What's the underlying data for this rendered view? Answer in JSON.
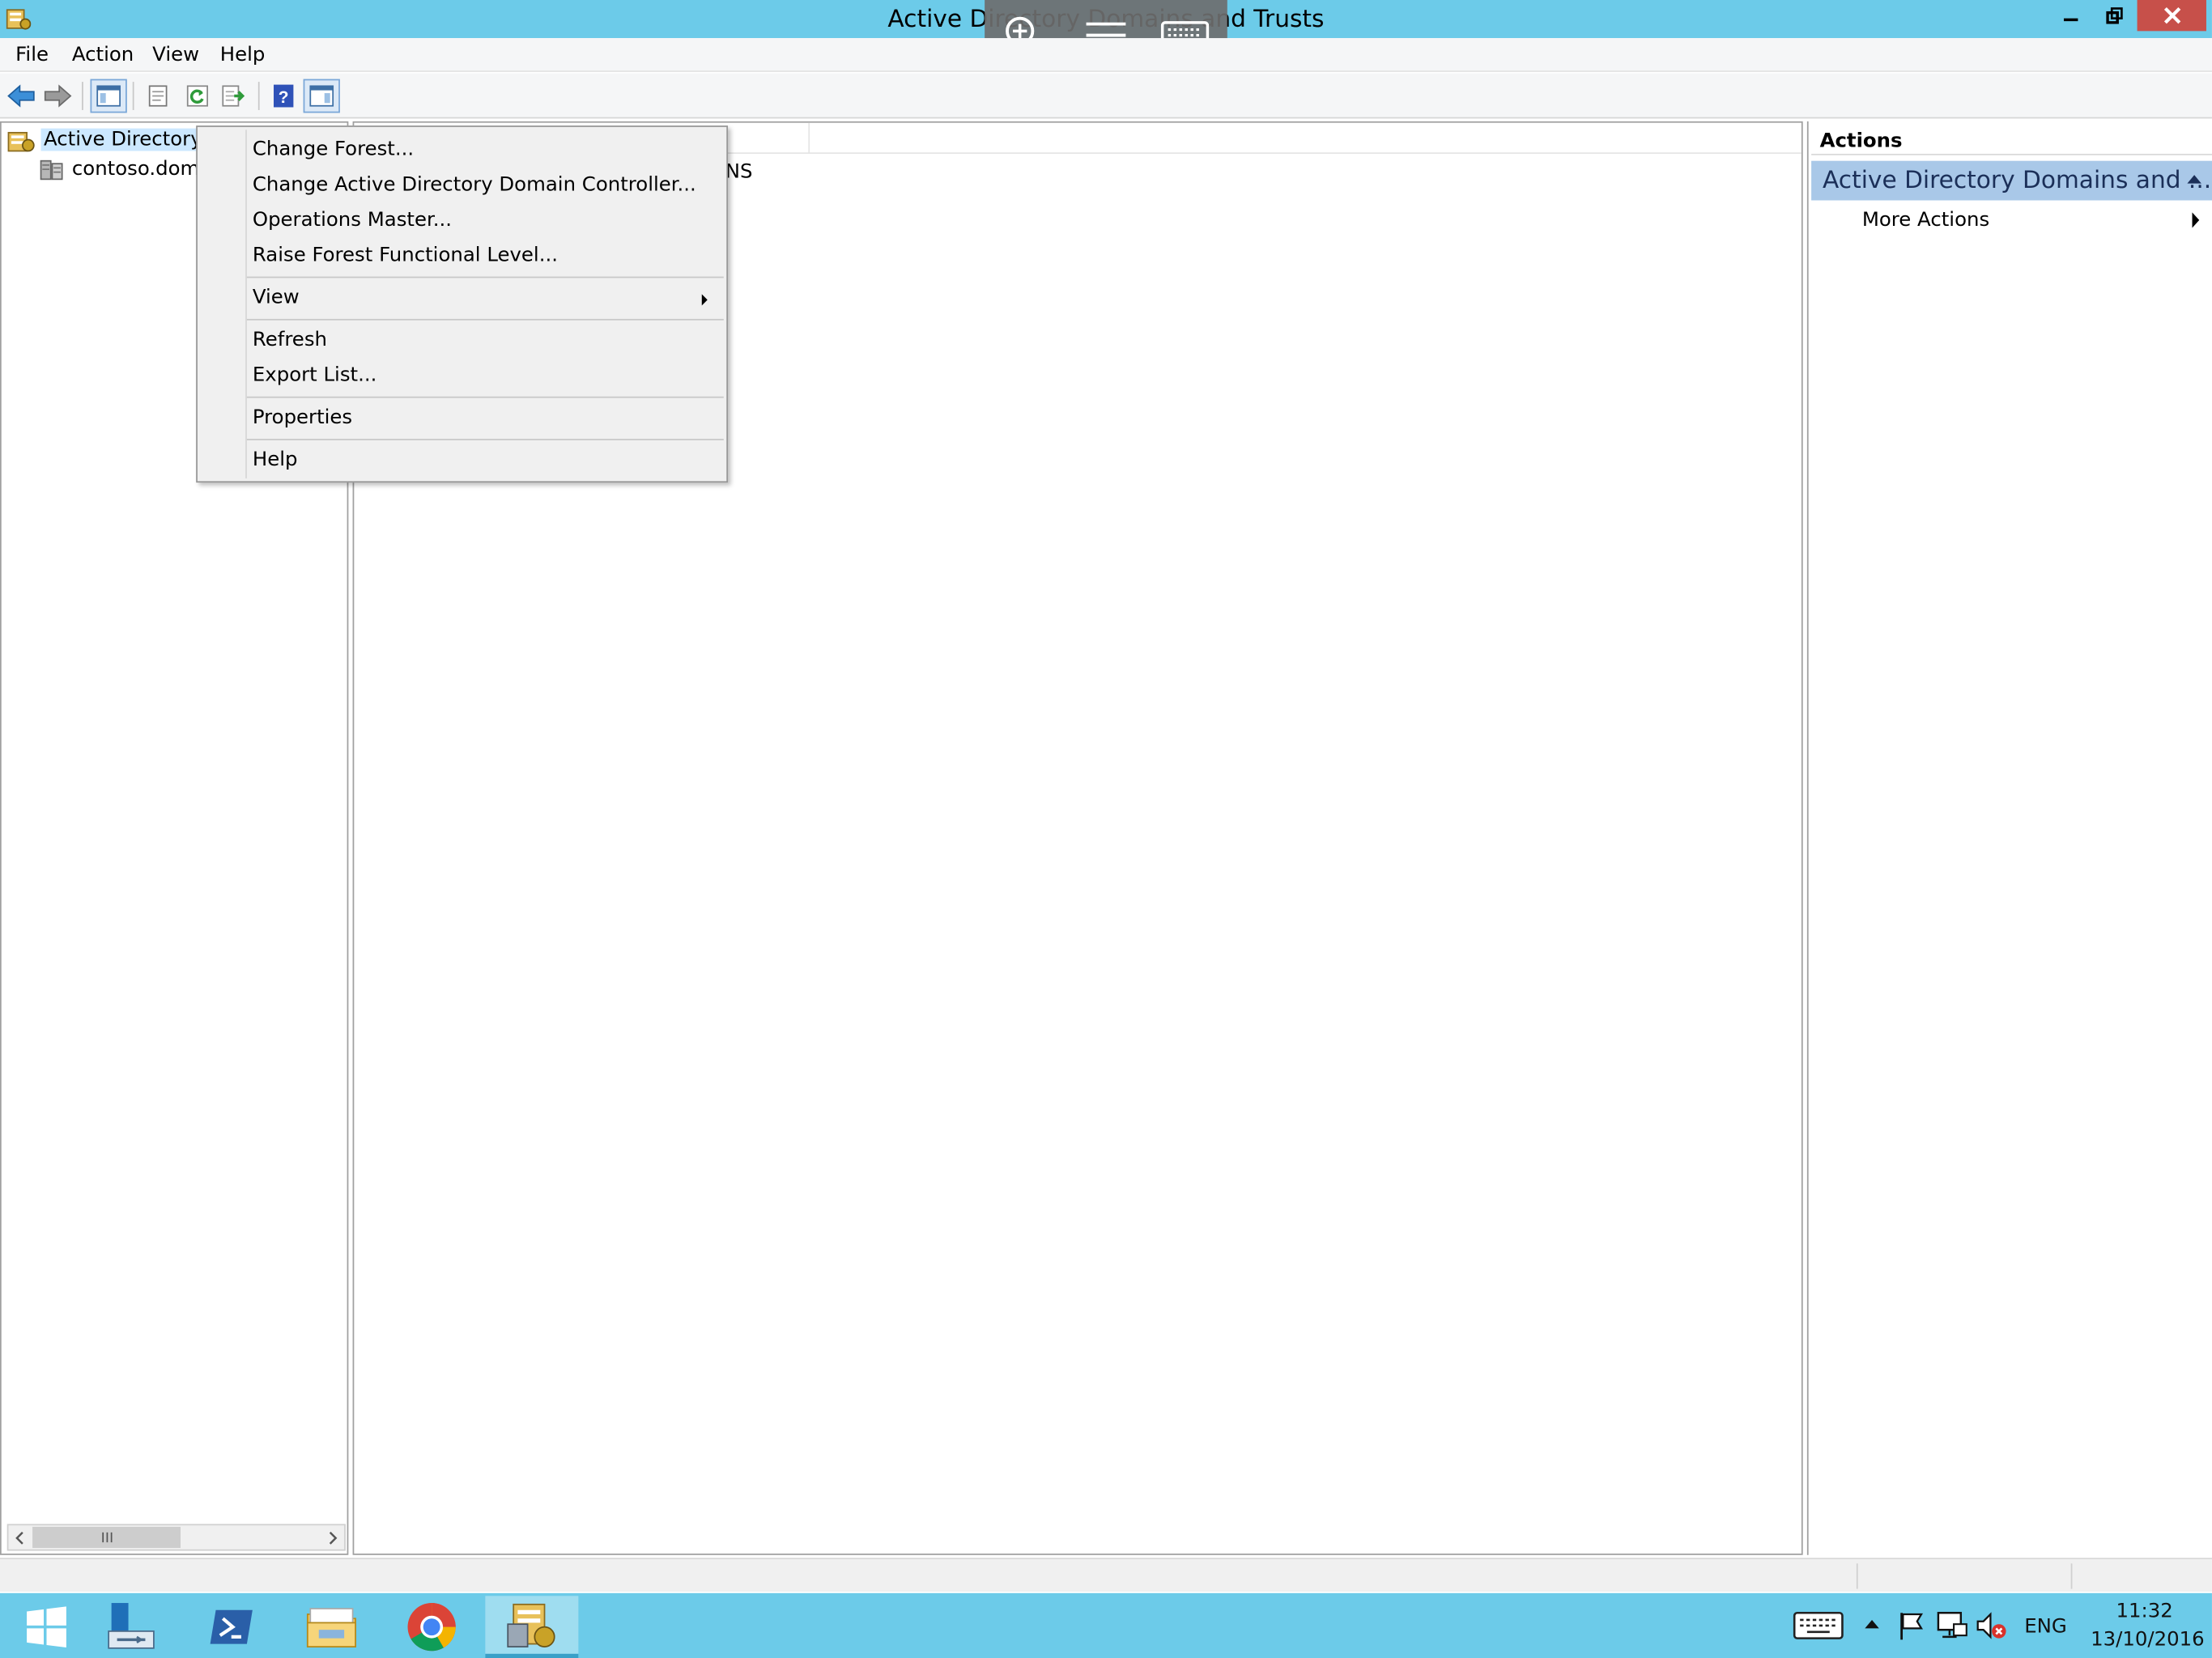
{
  "window": {
    "title": "Active Directory Domains and Trusts"
  },
  "menubar": {
    "items": [
      "File",
      "Action",
      "View",
      "Help"
    ]
  },
  "tree": {
    "root_label": "Active Directory D",
    "child_label": "contoso.doma"
  },
  "list": {
    "header_fragment": "e",
    "type_value": "ainDNS"
  },
  "actions": {
    "header": "Actions",
    "group_title": "Active Directory Domains and ...",
    "more_actions": "More Actions"
  },
  "context_menu": {
    "change_forest": "Change Forest...",
    "change_dc": "Change Active Directory Domain Controller...",
    "operations_master": "Operations Master...",
    "raise_forest": "Raise Forest Functional Level...",
    "view": "View",
    "refresh": "Refresh",
    "export_list": "Export List...",
    "properties": "Properties",
    "help": "Help"
  },
  "taskbar": {
    "language": "ENG",
    "time": "11:32",
    "date": "13/10/2016"
  },
  "colors": {
    "titlebar": "#6ccbe9",
    "taskbar": "#6ccbe9",
    "close_button": "#c7504a",
    "actions_group": "#a9c8e8",
    "selection": "#cce8ff"
  },
  "icons": {
    "title_app": "ad-domains-trusts-icon",
    "rd_zoom": "zoom-in-icon",
    "rd_menu": "hamburger-menu-icon",
    "rd_keyboard": "keyboard-icon",
    "toolbar": [
      "back-arrow-icon",
      "forward-arrow-icon",
      "show-hide-console-tree-icon",
      "properties-icon",
      "refresh-icon",
      "export-list-icon",
      "help-icon",
      "show-hide-action-pane-icon"
    ],
    "taskbar": [
      "start-icon",
      "server-manager-icon",
      "powershell-icon",
      "file-explorer-icon",
      "chrome-icon",
      "ad-domains-trusts-icon"
    ]
  }
}
